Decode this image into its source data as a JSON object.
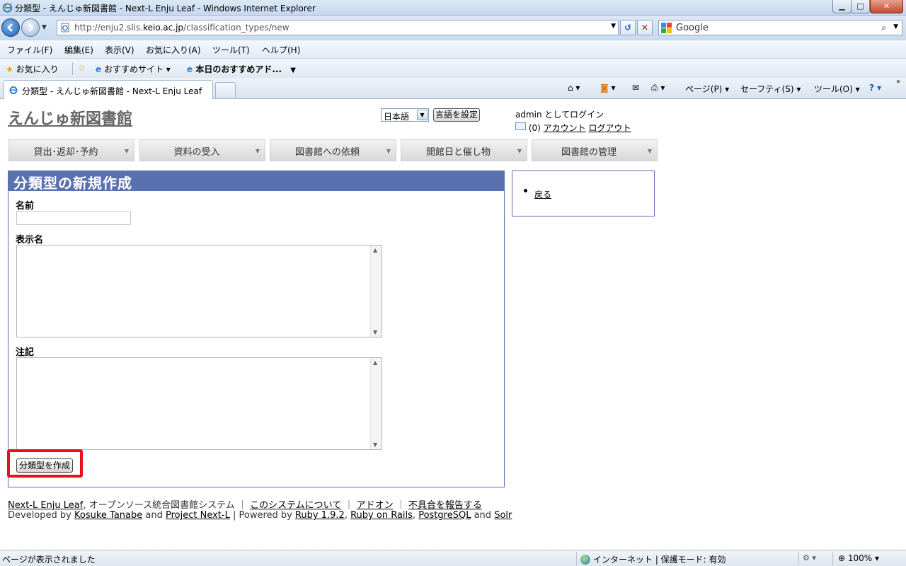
{
  "window": {
    "title": "分類型 - えんじゅ新図書館 - Next-L Enju Leaf - Windows Internet Explorer",
    "min_glyph": "▁",
    "max_glyph": "□",
    "close_glyph": "✕"
  },
  "address": {
    "url_prefix": "http://enju2.slis.",
    "url_domain": "keio.ac.jp",
    "url_path": "/classification_types/new",
    "search_engine": "Google"
  },
  "menu": [
    "ファイル(F)",
    "編集(E)",
    "表示(V)",
    "お気に入り(A)",
    "ツール(T)",
    "ヘルプ(H)"
  ],
  "favorites": {
    "favorites_label": "お気に入り",
    "suggested_sites": "おすすめサイト ▾",
    "web_slice": "本日のおすすめアド..."
  },
  "tab": {
    "label": "分類型 - えんじゅ新図書館 - Next-L Enju Leaf"
  },
  "commands": {
    "page": "ページ(P) ▾",
    "safety": "セーフティ(S) ▾",
    "tools": "ツール(O) ▾"
  },
  "site": {
    "title": "えんじゅ新図書館",
    "language_value": "日本語",
    "language_button": "言語を設定",
    "login_text": "admin としてログイン",
    "message_count": "(0)",
    "account_link": "アカウント",
    "logout_link": "ログアウト"
  },
  "nav": [
    "貸出･返却･予約",
    "資料の受入",
    "図書館への依頼",
    "開館日と催し物",
    "図書館の管理"
  ],
  "form": {
    "heading": "分類型の新規作成",
    "name_label": "名前",
    "display_name_label": "表示名",
    "note_label": "注記",
    "submit_label": "分類型を作成"
  },
  "sidebar": {
    "back_link": "戻る"
  },
  "footer": {
    "line1": {
      "product_link": "Next-L Enju Leaf",
      "description": ", オープンソース統合図書館システム ｜",
      "about_link": "このシステムについて",
      "sep1": "｜",
      "addon_link": "アドオン",
      "sep2": "｜",
      "report_link": "不具合を報告する"
    },
    "line2": {
      "developed_by": "Developed by",
      "author_link": "Kosuke Tanabe",
      "and1": "and",
      "project_link": "Project Next-L",
      "powered_by": "| Powered by",
      "ruby_link": "Ruby 1.9.2",
      "comma1": ",",
      "rails_link": "Ruby on Rails",
      "comma2": ",",
      "postgres_link": "PostgreSQL",
      "and2": "and",
      "solr_link": "Solr"
    }
  },
  "status": {
    "message": "ページが表示されました",
    "zone": "インターネット | 保護モード: 有効",
    "zoom": "100%"
  }
}
